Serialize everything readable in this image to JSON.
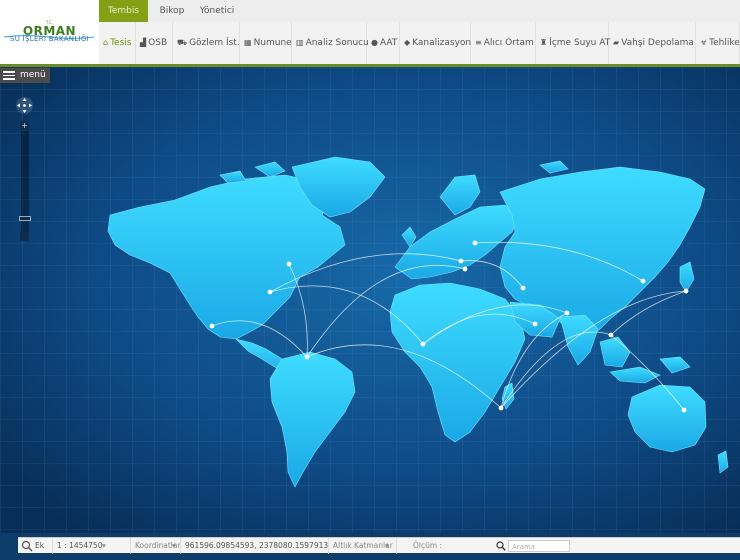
{
  "logo": {
    "small": "T.C.",
    "title": "ORMAN",
    "subtitle": "SU İŞLERİ BAKANLIĞI"
  },
  "top_tabs": [
    {
      "label": "Tembis",
      "active": true
    },
    {
      "label": "Bikop",
      "active": false
    },
    {
      "label": "Yönetici",
      "active": false
    }
  ],
  "menu": [
    {
      "label": "Tesis",
      "icon": "home-icon",
      "active": true
    },
    {
      "label": "OSB",
      "icon": "factory-icon",
      "active": false
    },
    {
      "label": "Gözlem İst.",
      "icon": "car-icon",
      "active": false
    },
    {
      "label": "Numune",
      "icon": "grid-icon",
      "active": false
    },
    {
      "label": "Analiz Sonucu",
      "icon": "chart-icon",
      "active": false
    },
    {
      "label": "AAT",
      "icon": "drop-icon",
      "active": false
    },
    {
      "label": "Kanalizasyon",
      "icon": "tank-icon",
      "active": false
    },
    {
      "label": "Alıcı Ortam",
      "icon": "list-icon",
      "active": false
    },
    {
      "label": "İçme Suyu AT",
      "icon": "bottle-icon",
      "active": false
    },
    {
      "label": "Vahşi Depolama",
      "icon": "book-icon",
      "active": false
    },
    {
      "label": "Tehlike",
      "icon": "hazard-icon",
      "active": false
    }
  ],
  "map": {
    "menu_label": "menü",
    "background_color": "#0b3a6e",
    "land_color": "#2bd0f5"
  },
  "bottom": {
    "zoom_label": "Ek",
    "scale": "1 : 1454750",
    "coord_label": "Koordinatlar",
    "coord_value": "961596.09854593, 2378080.1597913",
    "layers_label": "Altlık Katmanlar",
    "measure_label": "Ölçüm :",
    "search_placeholder": "Arama"
  }
}
